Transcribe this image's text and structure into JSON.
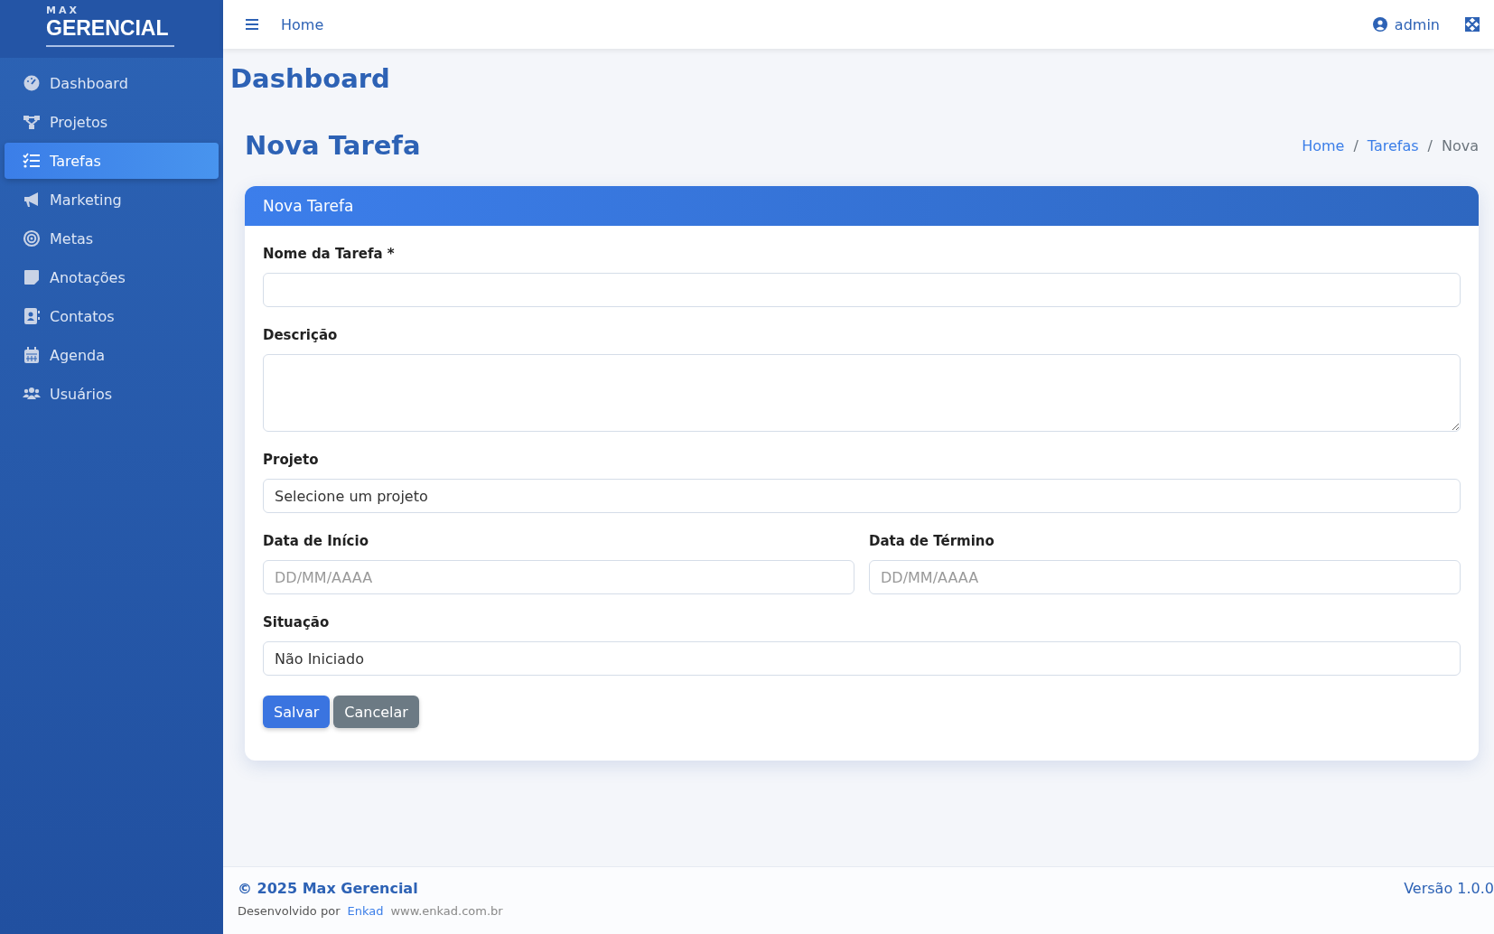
{
  "logo": {
    "small": "MAX",
    "big": "GERENCIAL"
  },
  "sidebar": {
    "items": [
      {
        "label": "Dashboard",
        "kind": "gauge",
        "selected": false
      },
      {
        "label": "Projetos",
        "kind": "diagram",
        "selected": false
      },
      {
        "label": "Tarefas",
        "kind": "tasks",
        "selected": true
      },
      {
        "label": "Marketing",
        "kind": "megaphone",
        "selected": false
      },
      {
        "label": "Metas",
        "kind": "target",
        "selected": false
      },
      {
        "label": "Anotações",
        "kind": "note",
        "selected": false
      },
      {
        "label": "Contatos",
        "kind": "contact",
        "selected": false
      },
      {
        "label": "Agenda",
        "kind": "calendar",
        "selected": false
      },
      {
        "label": "Usuários",
        "kind": "users",
        "selected": false
      }
    ]
  },
  "topbar": {
    "home_link": "Home",
    "user": "admin"
  },
  "page_title": "Dashboard",
  "section_title": "Nova Tarefa",
  "breadcrumb": [
    {
      "label": "Home",
      "current": false
    },
    {
      "separator": "/",
      "label": "Tarefas",
      "current": false
    },
    {
      "separator": "/",
      "label": "Nova",
      "current": true
    }
  ],
  "card": {
    "title": "Nova Tarefa",
    "rows": [
      {
        "fields": [
          {
            "label": "Nome da Tarefa *",
            "kind": "text"
          }
        ]
      },
      {
        "fields": [
          {
            "label": "Descrição",
            "kind": "textarea"
          }
        ]
      },
      {
        "fields": [
          {
            "label": "Projeto",
            "kind": "select",
            "value": "Selecione um projeto"
          }
        ]
      },
      {
        "fields": [
          {
            "label": "Data de Início",
            "kind": "text",
            "placeholder": "DD/MM/AAAA"
          },
          {
            "label": "Data de Término",
            "kind": "text",
            "placeholder": "DD/MM/AAAA"
          }
        ]
      },
      {
        "fields": [
          {
            "label": "Situação",
            "kind": "select",
            "value": "Não Iniciado"
          }
        ]
      }
    ],
    "buttons": [
      {
        "label": "Salvar",
        "kind": "primary"
      },
      {
        "label": "Cancelar",
        "kind": "secondary"
      }
    ]
  },
  "footer": {
    "copyright": "© 2025 Max Gerencial",
    "developed_by": "Desenvolvido por",
    "company": "Enkad",
    "website": "www.enkad.com.br",
    "version": "Versão 1.0.0"
  }
}
